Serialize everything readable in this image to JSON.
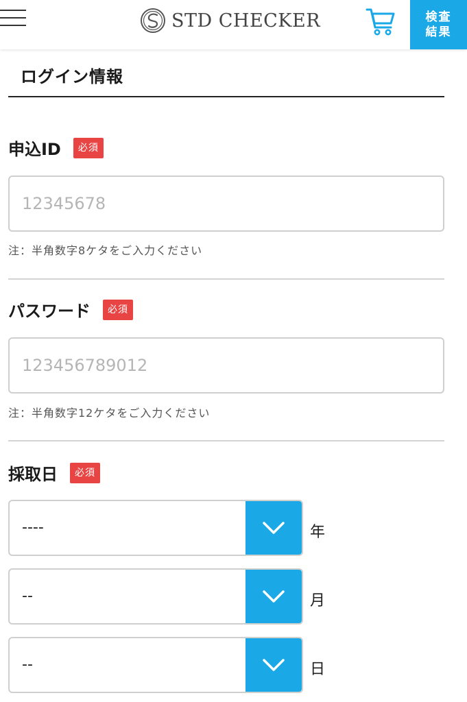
{
  "header": {
    "logo_text": "STD CHECKER",
    "results_line1": "検査",
    "results_line2": "結果",
    "accent_color": "#1aa8e6"
  },
  "section": {
    "title": "ログイン情報"
  },
  "required_badge": "必須",
  "fields": {
    "application_id": {
      "label": "申込ID",
      "placeholder": "12345678",
      "value": "",
      "note": "注：半角数字8ケタをご入力ください"
    },
    "password": {
      "label": "パスワード",
      "placeholder": "123456789012",
      "value": "",
      "note": "注：半角数字12ケタをご入力ください"
    },
    "collection_date": {
      "label": "採取日",
      "year": {
        "value": "----",
        "unit": "年"
      },
      "month": {
        "value": "--",
        "unit": "月"
      },
      "day": {
        "value": "--",
        "unit": "日"
      }
    }
  },
  "icons": {
    "menu": "hamburger-icon",
    "logo": "logo-mark-icon",
    "cart": "cart-icon",
    "select_arrow": "chevron-down-icon"
  },
  "colors": {
    "required": "#e94444",
    "accent": "#1aa8e6"
  }
}
